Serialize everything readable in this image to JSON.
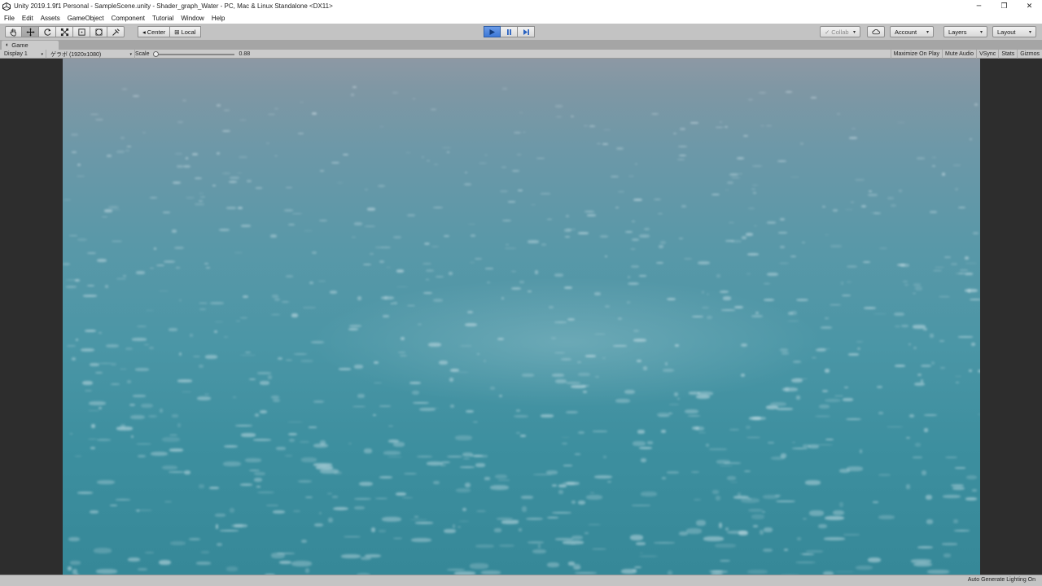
{
  "window": {
    "title": "Unity 2019.1.9f1 Personal - SampleScene.unity - Shader_graph_Water - PC, Mac & Linux Standalone <DX11>",
    "controls": [
      "─",
      "❐",
      "✕"
    ]
  },
  "menu": [
    "File",
    "Edit",
    "Assets",
    "GameObject",
    "Component",
    "Tutorial",
    "Window",
    "Help"
  ],
  "toolbar": {
    "tools": [
      "hand-tool-icon",
      "move-tool-icon",
      "rotate-tool-icon",
      "scale-tool-icon",
      "rect-tool-icon",
      "transform-tool-icon",
      "custom-tool-icon"
    ],
    "pivot_center_label": "Center",
    "pivot_local_label": "Local",
    "playback": [
      "play-icon",
      "pause-icon",
      "step-icon"
    ],
    "collab_label": "Collab",
    "account_label": "Account",
    "layers_label": "Layers",
    "layout_label": "Layout"
  },
  "game_tab": {
    "label": "Game"
  },
  "game_view": {
    "display_label": "Display 1",
    "resolution_label": "ゲラボ (1920x1080)",
    "scale_label": "Scale",
    "scale_value": "0.88",
    "scale_fraction": 0.02,
    "toggles": [
      "Maximize On Play",
      "Mute Audio",
      "VSync",
      "Stats",
      "Gizmos"
    ]
  },
  "statusbar": {
    "text": "Auto Generate Lighting On"
  },
  "colors": {
    "play_active": "#3d78d8",
    "viewport_border": "#2d2d2d",
    "water": "#4b96a6"
  }
}
